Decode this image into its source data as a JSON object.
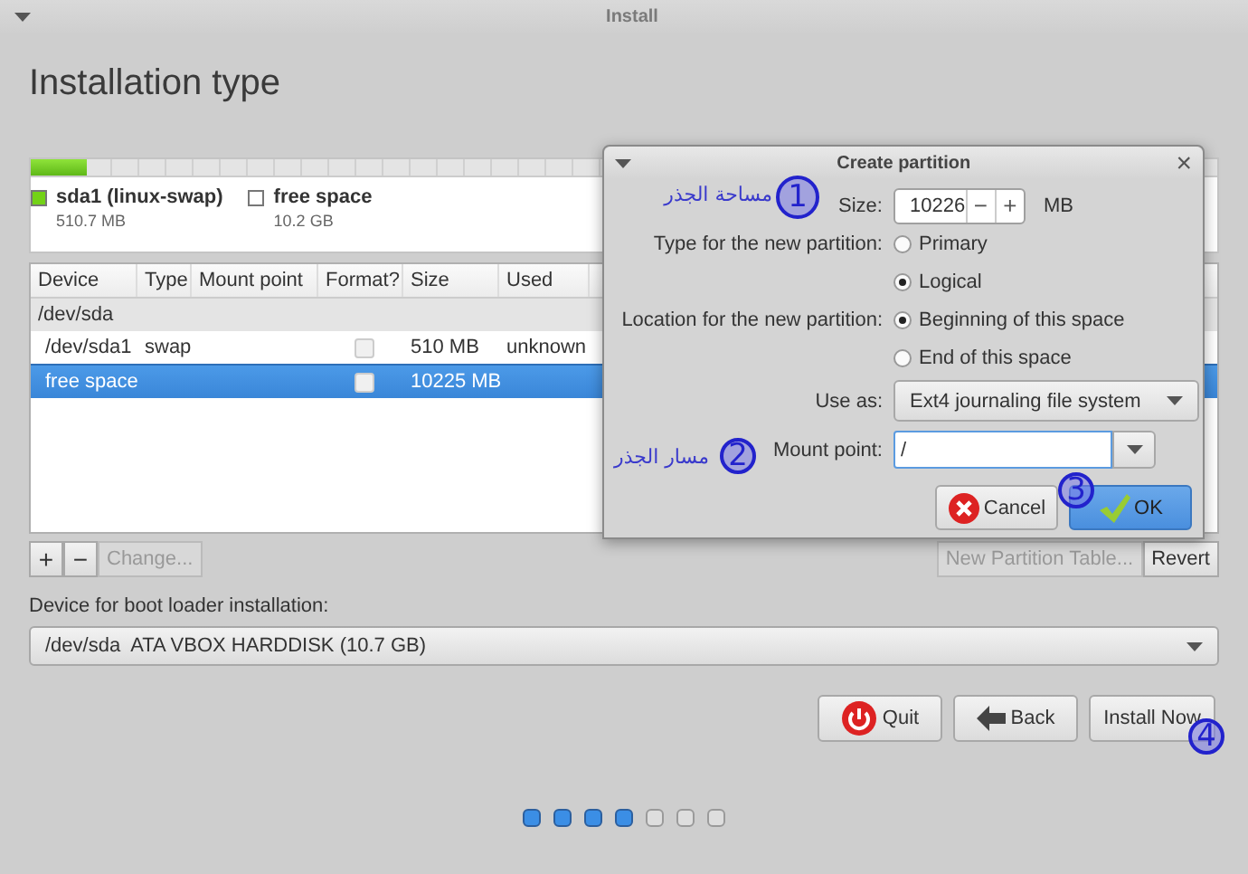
{
  "window": {
    "title": "Install"
  },
  "heading": "Installation type",
  "partition_bar": {
    "level": 0.047
  },
  "legend": [
    {
      "name": "sda1 (linux-swap)",
      "size": "510.7 MB",
      "color": "#73d216"
    },
    {
      "name": "free space",
      "size": "10.2 GB",
      "color": "#ffffff"
    }
  ],
  "table": {
    "columns": [
      "Device",
      "Type",
      "Mount point",
      "Format?",
      "Size",
      "Used"
    ],
    "rows": [
      {
        "kind": "disk",
        "device": "/dev/sda",
        "selected": false
      },
      {
        "kind": "partition",
        "device": "/dev/sda1",
        "type": "swap",
        "format_checked": false,
        "size": "510 MB",
        "used": "unknown",
        "selected": false
      },
      {
        "kind": "partition",
        "device": "free space",
        "format_checked": false,
        "size": "10225 MB",
        "selected": true
      }
    ]
  },
  "partition_buttons": [
    {
      "label": "+",
      "disabled": false
    },
    {
      "label": "−",
      "disabled": false
    },
    {
      "label": "Change...",
      "disabled": true
    }
  ],
  "table_buttons": [
    {
      "label": "New Partition Table...",
      "disabled": true
    },
    {
      "label": "Revert",
      "disabled": false
    }
  ],
  "bootloader": {
    "label": "Device for boot loader installation:",
    "value": "/dev/sda  ATA VBOX HARDDISK (10.7 GB)"
  },
  "nav_buttons": [
    {
      "kind": "quit",
      "label": "Quit"
    },
    {
      "kind": "back",
      "label": "Back"
    },
    {
      "kind": "install",
      "label": "Install Now"
    }
  ],
  "steps": [
    {
      "done": true
    },
    {
      "done": true
    },
    {
      "done": true
    },
    {
      "done": true
    },
    {
      "done": false
    },
    {
      "done": false
    },
    {
      "done": false
    }
  ],
  "dialog": {
    "title": "Create partition",
    "close": "×",
    "size": {
      "label": "Size:",
      "value": "10226",
      "decrement": "−",
      "increment": "+",
      "unit": "MB"
    },
    "type": {
      "label": "Type for the new partition:",
      "options": [
        {
          "label": "Primary",
          "selected": false
        },
        {
          "label": "Logical",
          "selected": true
        }
      ]
    },
    "location": {
      "label": "Location for the new partition:",
      "options": [
        {
          "label": "Beginning of this space",
          "selected": true
        },
        {
          "label": "End of this space",
          "selected": false
        }
      ]
    },
    "use_as": {
      "label": "Use as:",
      "value": "Ext4 journaling file system"
    },
    "mount_point": {
      "label": "Mount point:",
      "value": "/"
    },
    "buttons": [
      {
        "kind": "cancel",
        "label": "Cancel",
        "default": false
      },
      {
        "kind": "ok",
        "label": "OK",
        "default": true
      }
    ]
  },
  "annotations": [
    {
      "number": "1",
      "note": "مساحة الجذر"
    },
    {
      "number": "2",
      "note": "مسار الجذر"
    },
    {
      "number": "3"
    },
    {
      "number": "4"
    }
  ]
}
